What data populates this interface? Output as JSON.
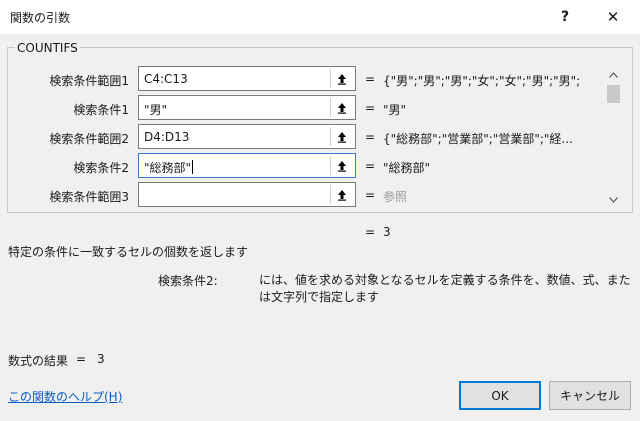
{
  "dialog": {
    "title": "関数の引数",
    "help_glyph": "?",
    "close_glyph": "✕"
  },
  "function_name": "COUNTIFS",
  "arguments": [
    {
      "label": "検索条件範囲1",
      "value": "C4:C13",
      "eq": "=",
      "result": "{\"男\";\"男\";\"男\";\"女\";\"女\";\"男\";\"男\";"
    },
    {
      "label": "検索条件1",
      "value": "\"男\"",
      "eq": "=",
      "result": "\"男\""
    },
    {
      "label": "検索条件範囲2",
      "value": "D4:D13",
      "eq": "=",
      "result": "{\"総務部\";\"営業部\";\"営業部\";\"経..."
    },
    {
      "label": "検索条件2",
      "value": "\"総務部\"",
      "eq": "=",
      "result": "\"総務部\""
    },
    {
      "label": "検索条件範囲3",
      "value": "",
      "eq": "=",
      "result": "参照"
    }
  ],
  "result_eq": "=",
  "result_value": "3",
  "function_description": "特定の条件に一致するセルの個数を返します",
  "arg_help": {
    "label": "検索条件2:",
    "text": "には、値を求める対象となるセルを定義する条件を、数値、式、または文字列で指定します"
  },
  "formula_result": {
    "label": "数式の結果",
    "eq": "=",
    "value": "3"
  },
  "help_link": "この関数のヘルプ(H)",
  "buttons": {
    "ok": "OK",
    "cancel": "キャンセル"
  }
}
